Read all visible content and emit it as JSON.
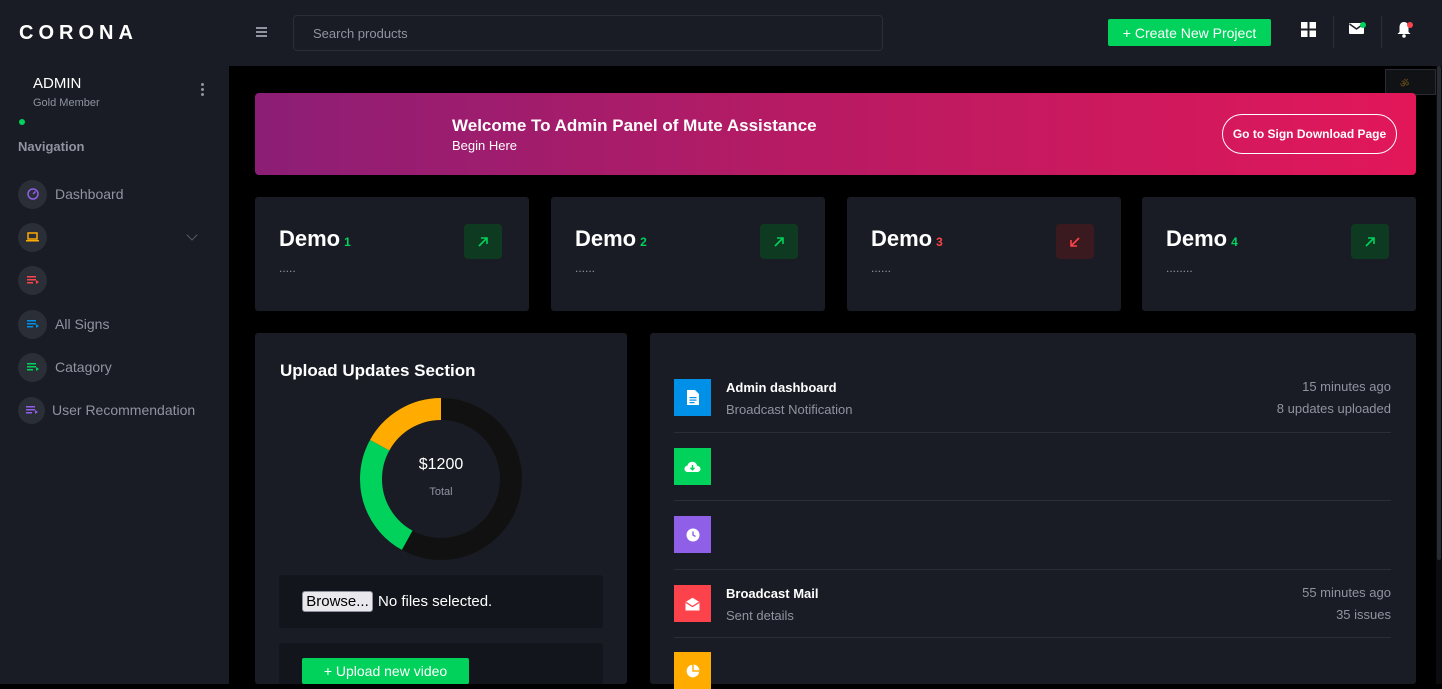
{
  "brand": "CORONA",
  "profile": {
    "name": "ADMIN",
    "role": "Gold Member"
  },
  "sidebar": {
    "section_title": "Navigation",
    "items": [
      {
        "label": "Dashboard",
        "icon": "speedometer-icon",
        "color": "#8f5fe8"
      },
      {
        "label": "",
        "icon": "laptop-icon",
        "color": "#ffab00"
      },
      {
        "label": "",
        "icon": "playlist-icon",
        "color": "#fc424a"
      },
      {
        "label": "All Signs",
        "icon": "playlist-icon",
        "color": "#0090e7"
      },
      {
        "label": "Catagory",
        "icon": "playlist-icon",
        "color": "#00d25b"
      },
      {
        "label": "User Recommendation",
        "icon": "playlist-icon",
        "color": "#8f5fe8"
      }
    ]
  },
  "header": {
    "search_placeholder": "Search products",
    "create_button": "+ Create New Project",
    "icons": [
      "grid-icon",
      "mail-icon",
      "bell-icon"
    ]
  },
  "banner": {
    "title": "Welcome To Admin Panel of Mute Assistance",
    "subtitle": "Begin Here",
    "button": "Go to Sign Download Page"
  },
  "stats": [
    {
      "title": "Demo",
      "num": "1",
      "dots": ".....",
      "trend": "up",
      "color": "#00d25b"
    },
    {
      "title": "Demo",
      "num": "2",
      "dots": "......",
      "trend": "up",
      "color": "#00d25b"
    },
    {
      "title": "Demo",
      "num": "3",
      "dots": "......",
      "trend": "down",
      "color": "#fc424a"
    },
    {
      "title": "Demo",
      "num": "4",
      "dots": "........",
      "trend": "up",
      "color": "#00d25b"
    }
  ],
  "upload": {
    "title": "Upload Updates Section",
    "donut_value": "$1200",
    "donut_label": "Total",
    "donut_segments": [
      {
        "color": "#111111",
        "fraction": 0.58
      },
      {
        "color": "#00d25b",
        "fraction": 0.25
      },
      {
        "color": "#ffab00",
        "fraction": 0.17
      }
    ],
    "browse_label": "Browse...",
    "file_status": "No files selected.",
    "upload_button": "+ Upload new video"
  },
  "activities": [
    {
      "icon": "file-icon",
      "color": "#0090e7",
      "title": "Admin dashboard",
      "subtitle": "Broadcast Notification",
      "time": "15 minutes ago",
      "meta": "8 updates uploaded"
    },
    {
      "icon": "cloud-download-icon",
      "color": "#00d25b",
      "title": "",
      "subtitle": "",
      "time": "",
      "meta": ""
    },
    {
      "icon": "clock-icon",
      "color": "#8f5fe8",
      "title": "",
      "subtitle": "",
      "time": "",
      "meta": ""
    },
    {
      "icon": "email-open-icon",
      "color": "#fc424a",
      "title": "Broadcast Mail",
      "subtitle": "Sent details",
      "time": "55 minutes ago",
      "meta": "35 issues"
    },
    {
      "icon": "chart-pie-icon",
      "color": "#ffab00",
      "title": "",
      "subtitle": "",
      "time": "",
      "meta": ""
    }
  ],
  "colors": {
    "primary_bg": "#000000",
    "panel": "#191c24",
    "success": "#00d25b",
    "danger": "#fc424a",
    "muted": "#8f94a0"
  }
}
